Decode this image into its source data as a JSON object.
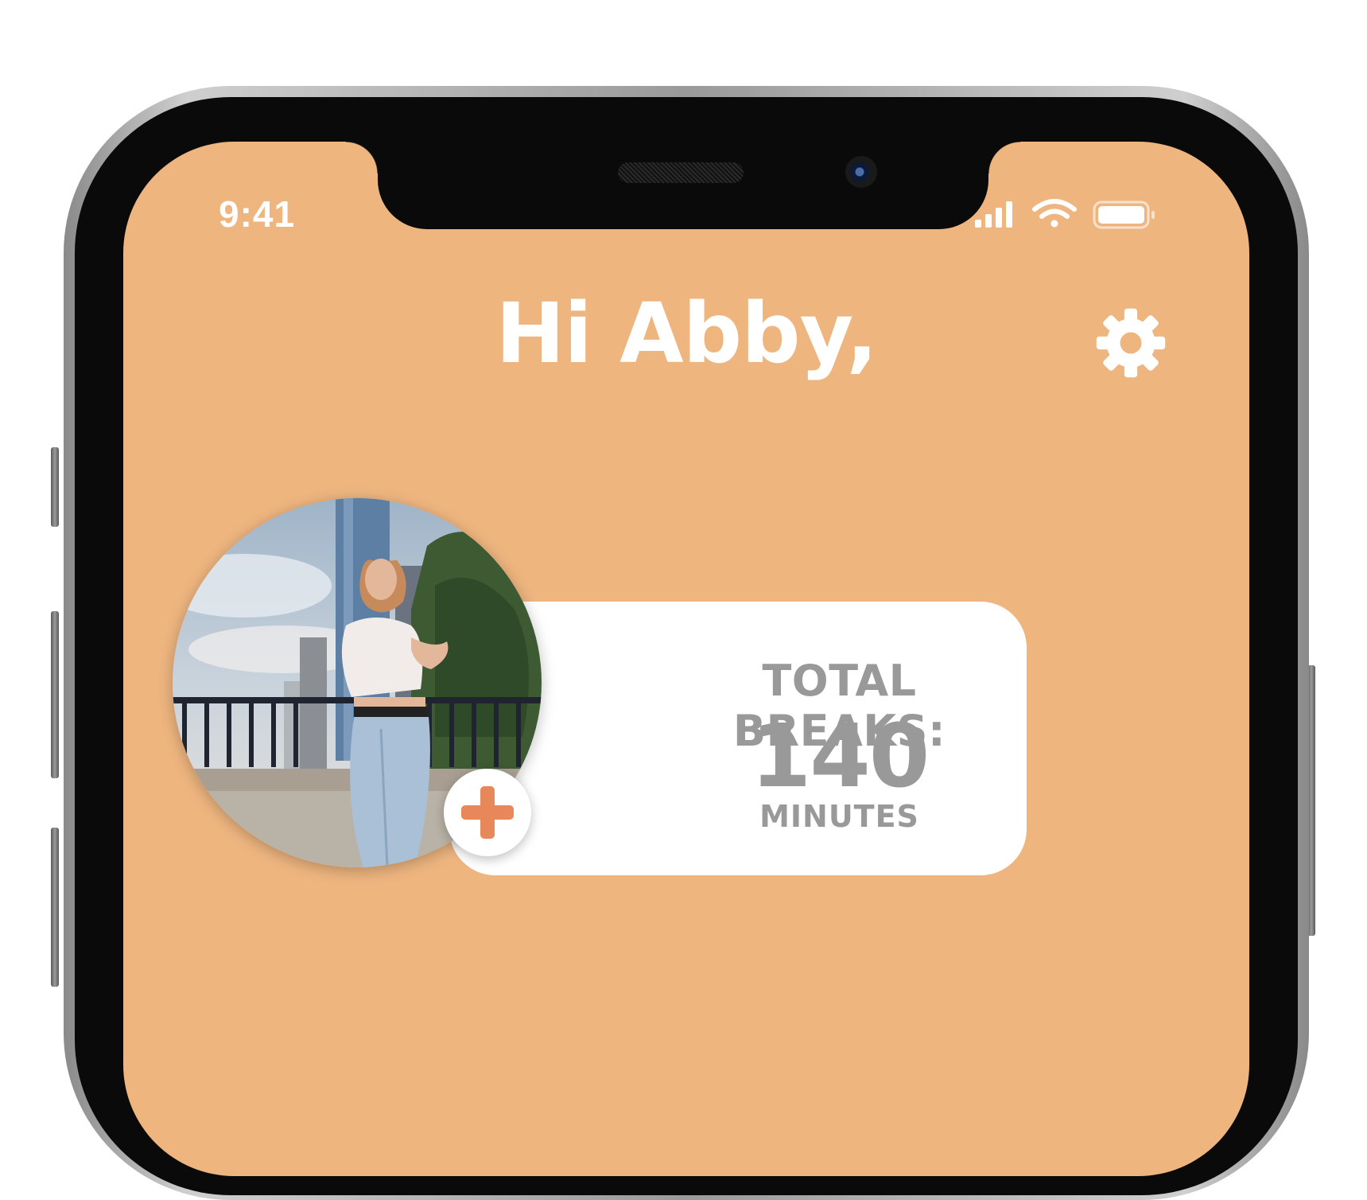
{
  "status_bar": {
    "time": "9:41"
  },
  "header": {
    "greeting": "Hi Abby,"
  },
  "profile": {
    "photo_alt": "Profile photo of Abby"
  },
  "stats_card": {
    "label": "TOTAL BREAKS:",
    "value": "140",
    "unit": "MINUTES"
  },
  "colors": {
    "background": "#eeb57f",
    "accent": "#e8875a",
    "card_text": "#999999"
  },
  "icons": [
    "signal-icon",
    "wifi-icon",
    "battery-icon",
    "gear-icon",
    "plus-icon"
  ]
}
